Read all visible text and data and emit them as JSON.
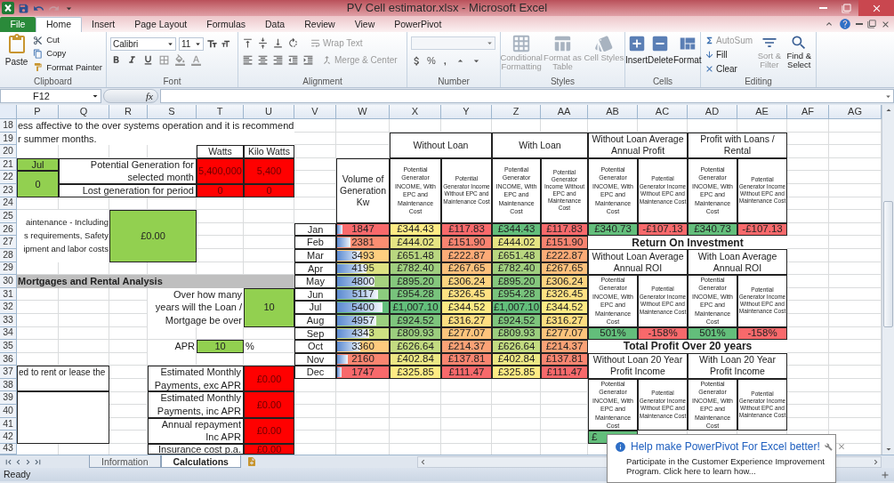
{
  "window": {
    "title": "PV Cell estimator.xlsx  -  Microsoft Excel"
  },
  "ribbon_tabs": [
    {
      "label": "File",
      "kind": "file",
      "selected": false
    },
    {
      "label": "Home",
      "kind": "tab",
      "selected": true
    },
    {
      "label": "Insert",
      "kind": "tab",
      "selected": false
    },
    {
      "label": "Page Layout",
      "kind": "tab",
      "selected": false
    },
    {
      "label": "Formulas",
      "kind": "tab",
      "selected": false
    },
    {
      "label": "Data",
      "kind": "tab",
      "selected": false
    },
    {
      "label": "Review",
      "kind": "tab",
      "selected": false
    },
    {
      "label": "View",
      "kind": "tab",
      "selected": false
    },
    {
      "label": "PowerPivot",
      "kind": "tab",
      "selected": false
    }
  ],
  "clipboard": {
    "label": "Clipboard",
    "paste": "Paste",
    "cut": "Cut",
    "copy": "Copy",
    "format_painter": "Format Painter"
  },
  "font": {
    "label": "Font",
    "name": "Calibri",
    "size": "11"
  },
  "alignment": {
    "label": "Alignment",
    "buttons": [
      {
        "label": "Wrap Text",
        "disabled": true
      },
      {
        "label": "Merge & Center",
        "disabled": true
      }
    ]
  },
  "number": {
    "label": "Number",
    "percent": "%",
    "comma": ","
  },
  "styles": {
    "label": "Styles",
    "buttons": [
      {
        "label": "Conditional Formatting",
        "disabled": true
      },
      {
        "label": "Format as Table",
        "disabled": true
      },
      {
        "label": "Cell Styles",
        "disabled": true
      }
    ]
  },
  "cells_group": {
    "label": "Cells",
    "buttons": [
      {
        "label": "Insert",
        "disabled": false
      },
      {
        "label": "Delete",
        "disabled": false
      },
      {
        "label": "Format",
        "disabled": false
      }
    ]
  },
  "editing": {
    "label": "Editing",
    "small": [
      {
        "label": "AutoSum",
        "disabled": true
      },
      {
        "label": "Fill",
        "disabled": false
      },
      {
        "label": "Clear",
        "disabled": false
      }
    ],
    "large": [
      {
        "label": "Sort & Filter",
        "disabled": true
      },
      {
        "label": "Find & Select",
        "disabled": false
      }
    ]
  },
  "formula_bar": {
    "name_box": "F12",
    "function_symbol": "fx"
  },
  "sheet": {
    "columns": [
      "P",
      "Q",
      "R",
      "S",
      "T",
      "U",
      "V",
      "W",
      "X",
      "Y",
      "Z",
      "AA",
      "AB",
      "AC",
      "AD",
      "AE",
      "AF",
      "AG"
    ],
    "rows": [
      "18",
      "19",
      "20",
      "21",
      "22",
      "23",
      "24",
      "25",
      "26",
      "27",
      "28",
      "29",
      "30",
      "31",
      "32",
      "33",
      "34",
      "35",
      "36",
      "37",
      "38",
      "39",
      "40",
      "41",
      "42",
      "43"
    ],
    "cells": [
      {
        "kind": "note",
        "text": "ess affective to the over systems operation and it is recommend"
      },
      {
        "kind": "note",
        "text": "r summer months."
      },
      {
        "kind": "header",
        "text": "Watts"
      },
      {
        "kind": "header",
        "text": "Kilo Watts"
      },
      {
        "kind": "input",
        "text": "Jul"
      },
      {
        "kind": "input",
        "text": "0"
      },
      {
        "kind": "label",
        "text": "Potential Generation for selected month"
      },
      {
        "kind": "output",
        "text": "5,400,000"
      },
      {
        "kind": "output",
        "text": "5,400"
      },
      {
        "kind": "label",
        "text": "Lost generation for period"
      },
      {
        "kind": "output",
        "text": "0"
      },
      {
        "kind": "output",
        "text": "0"
      },
      {
        "kind": "fragment",
        "lines": [
          "aintenance - Including",
          "s requirements, Safety",
          "ipment and labor costs"
        ]
      },
      {
        "kind": "input",
        "text": "£0.00"
      },
      {
        "kind": "section",
        "text": "Mortgages and Rental Analysis"
      },
      {
        "kind": "caption",
        "text": "Over how many years will the Loan / Mortgage be over"
      },
      {
        "kind": "input",
        "text": "10"
      },
      {
        "kind": "caption",
        "text": "APR"
      },
      {
        "kind": "input",
        "text": "10"
      },
      {
        "kind": "plain",
        "text": "%"
      },
      {
        "kind": "box",
        "text": "ed to rent or lease the"
      },
      {
        "kind": "box"
      },
      {
        "kind": "label",
        "text": "Estimated Monthly Payments, exc APR"
      },
      {
        "kind": "output",
        "text": "£0.00"
      },
      {
        "kind": "label",
        "text": "Estimated Monthly Payments, inc APR"
      },
      {
        "kind": "output",
        "text": "£0.00"
      },
      {
        "kind": "label",
        "text": "Annual repayment Inc APR"
      },
      {
        "kind": "output",
        "text": "£0.00"
      },
      {
        "kind": "label",
        "text": "Insurance cost p.a."
      },
      {
        "kind": "output",
        "text": "£0.00"
      },
      {
        "kind": "header",
        "text": "Without Loan"
      },
      {
        "kind": "header",
        "text": "With Loan"
      },
      {
        "kind": "header",
        "text": "Volume of Generation Kw"
      },
      {
        "kind": "subhead",
        "text": "Potential Generator INCOME, With EPC and Maintenance Cost"
      },
      {
        "kind": "minihead",
        "text": "Potential Generator Income Without EPC and Maintenance Cost"
      },
      {
        "kind": "subhead",
        "text": "Potential Generator INCOME, With EPC and Maintenance Cost"
      },
      {
        "kind": "microhead",
        "text": "Potential Generator Income Without EPC and Maintenance Cost"
      },
      {
        "kind": "header",
        "text": "Without Loan Average Annual Profit"
      },
      {
        "kind": "header",
        "text": "Profit with Loans / Rental"
      },
      {
        "kind": "subhead",
        "text": "Potential Generator INCOME, With EPC and Maintenance Cost"
      },
      {
        "kind": "minihead",
        "text": "Potential Generator Income Without EPC and Maintenance Cost"
      },
      {
        "kind": "subhead",
        "text": "Potential Generator INCOME, With EPC and Maintenance Cost"
      },
      {
        "kind": "microhead",
        "text": "Potential Generator Income Without EPC and Maintenance Cost"
      },
      {
        "kind": "value",
        "text": "£340.73",
        "color": "#63be7b"
      },
      {
        "kind": "value",
        "text": "-£107.13",
        "color": "#f8696b"
      },
      {
        "kind": "value",
        "text": "£340.73",
        "color": "#63be7b"
      },
      {
        "kind": "value",
        "text": "-£107.13",
        "color": "#f8696b"
      },
      {
        "kind": "title",
        "text": "Return On Investment"
      },
      {
        "kind": "header",
        "text": "Without Loan Average Annual ROI"
      },
      {
        "kind": "header",
        "text": "With Loan Average Annual ROI"
      },
      {
        "kind": "subhead",
        "text": "Potential Generator INCOME, With EPC and Maintenance Cost"
      },
      {
        "kind": "minihead",
        "text": "Potential Generator Income Without EPC and Maintenance Cost"
      },
      {
        "kind": "subhead",
        "text": "Potential Generator INCOME, With EPC and Maintenance Cost"
      },
      {
        "kind": "microhead",
        "text": "Potential Generator Income Without EPC and Maintenance Cost"
      },
      {
        "kind": "value",
        "text": "501%",
        "color": "#63be7b"
      },
      {
        "kind": "value",
        "text": "-158%",
        "color": "#f8696b"
      },
      {
        "kind": "value",
        "text": "501%",
        "color": "#63be7b"
      },
      {
        "kind": "value",
        "text": "-158%",
        "color": "#f8696b"
      },
      {
        "kind": "title",
        "text": "Total Profit Over 20 years"
      },
      {
        "kind": "header",
        "text": "Without Loan 20 Year Profit Income"
      },
      {
        "kind": "header",
        "text": "With Loan 20 Year Profit Income"
      },
      {
        "kind": "subhead",
        "text": "Potential Generator INCOME, With EPC and Maintenance Cost"
      },
      {
        "kind": "minihead",
        "text": "Potential Generator Income Without EPC and Maintenance Cost"
      },
      {
        "kind": "subhead",
        "text": "Potential Generator INCOME, With EPC and Maintenance Cost"
      },
      {
        "kind": "microhead",
        "text": "Potential Generator Income Without EPC and Maintenance Cost"
      },
      {
        "kind": "stub",
        "text": "£",
        "color": "#63be7b"
      }
    ],
    "months": [
      {
        "month": "Jan",
        "kw": "1847",
        "level": 0.1,
        "color": "#f8696b",
        "values": [
          {
            "text": "£344.43",
            "color": "#ffeb84"
          },
          {
            "text": "£117.83",
            "color": "#f8696b"
          },
          {
            "text": "£344.43",
            "color": "#63be7b"
          },
          {
            "text": "£117.83",
            "color": "#f8696b"
          }
        ]
      },
      {
        "month": "Feb",
        "kw": "2381",
        "level": 0.25,
        "color": "#fa8e72",
        "values": [
          {
            "text": "£444.02",
            "color": "#e6e483"
          },
          {
            "text": "£151.90",
            "color": "#f98370"
          },
          {
            "text": "£444.02",
            "color": "#e6e483"
          },
          {
            "text": "£151.90",
            "color": "#f98370"
          }
        ]
      },
      {
        "month": "Mar",
        "kw": "3493",
        "level": 0.45,
        "color": "#fece7f",
        "values": [
          {
            "text": "£651.48",
            "color": "#b9d780"
          },
          {
            "text": "£222.87",
            "color": "#fcab77"
          },
          {
            "text": "£651.48",
            "color": "#b9d780"
          },
          {
            "text": "£222.87",
            "color": "#fcab77"
          }
        ]
      },
      {
        "month": "Apr",
        "kw": "4195",
        "level": 0.57,
        "color": "#dde283",
        "values": [
          {
            "text": "£782.40",
            "color": "#a0cf7f"
          },
          {
            "text": "£267.65",
            "color": "#fdc17c"
          },
          {
            "text": "£782.40",
            "color": "#a0cf7f"
          },
          {
            "text": "£267.65",
            "color": "#fdc17c"
          }
        ]
      },
      {
        "month": "May",
        "kw": "4800",
        "level": 0.72,
        "color": "#a6d17f",
        "values": [
          {
            "text": "£895.20",
            "color": "#85c77d"
          },
          {
            "text": "£306.24",
            "color": "#fed480"
          },
          {
            "text": "£895.20",
            "color": "#85c77d"
          },
          {
            "text": "£306.24",
            "color": "#fed480"
          }
        ]
      },
      {
        "month": "Jun",
        "kw": "5117",
        "level": 0.8,
        "color": "#8ccb7e",
        "values": [
          {
            "text": "£954.28",
            "color": "#78c37c"
          },
          {
            "text": "£326.45",
            "color": "#ffe183"
          },
          {
            "text": "£954.28",
            "color": "#78c37c"
          },
          {
            "text": "£326.45",
            "color": "#ffe183"
          }
        ]
      },
      {
        "month": "Jul",
        "kw": "5400",
        "level": 0.88,
        "color": "#63be7b",
        "values": [
          {
            "text": "£1,007.10",
            "color": "#63be7b"
          },
          {
            "text": "£344.52",
            "color": "#ffeb84"
          },
          {
            "text": "£1,007.10",
            "color": "#63be7b"
          },
          {
            "text": "£344.52",
            "color": "#ffeb84"
          }
        ]
      },
      {
        "month": "Aug",
        "kw": "4957",
        "level": 0.76,
        "color": "#9cd07f",
        "values": [
          {
            "text": "£924.52",
            "color": "#7ec57d"
          },
          {
            "text": "£316.27",
            "color": "#fede81"
          },
          {
            "text": "£924.52",
            "color": "#7ec57d"
          },
          {
            "text": "£316.27",
            "color": "#fede81"
          }
        ]
      },
      {
        "month": "Sep",
        "kw": "4343",
        "level": 0.62,
        "color": "#cde082",
        "values": [
          {
            "text": "£809.93",
            "color": "#9bcd7e"
          },
          {
            "text": "£277.07",
            "color": "#fdc47c"
          },
          {
            "text": "£809.93",
            "color": "#9bcd7e"
          },
          {
            "text": "£277.07",
            "color": "#fdc47c"
          }
        ]
      },
      {
        "month": "Oct",
        "kw": "3360",
        "level": 0.45,
        "color": "#fecb7e",
        "values": [
          {
            "text": "£626.64",
            "color": "#c3db81"
          },
          {
            "text": "£214.37",
            "color": "#fba276"
          },
          {
            "text": "£626.64",
            "color": "#c3db81"
          },
          {
            "text": "£214.37",
            "color": "#fba276"
          }
        ]
      },
      {
        "month": "Nov",
        "kw": "2160",
        "level": 0.2,
        "color": "#f98570",
        "values": [
          {
            "text": "£402.84",
            "color": "#ece784"
          },
          {
            "text": "£137.81",
            "color": "#f98570"
          },
          {
            "text": "£402.84",
            "color": "#ece784"
          },
          {
            "text": "£137.81",
            "color": "#f98570"
          }
        ]
      },
      {
        "month": "Dec",
        "kw": "1747",
        "level": 0.08,
        "color": "#f8696b",
        "values": [
          {
            "text": "£325.85",
            "color": "#ffeb84"
          },
          {
            "text": "£111.47",
            "color": "#f8696b"
          },
          {
            "text": "£325.85",
            "color": "#ffeb84"
          },
          {
            "text": "£111.47",
            "color": "#f8696b"
          }
        ]
      }
    ]
  },
  "sheet_tabs": [
    {
      "label": "Information",
      "selected": false
    },
    {
      "label": "Calculations",
      "selected": true
    }
  ],
  "status_bar": {
    "text": "Ready"
  },
  "notification": {
    "title": "Help make PowerPivot For Excel better!",
    "body": "Participate in the Customer Experience Improvement Program.  Click here to learn how..."
  }
}
